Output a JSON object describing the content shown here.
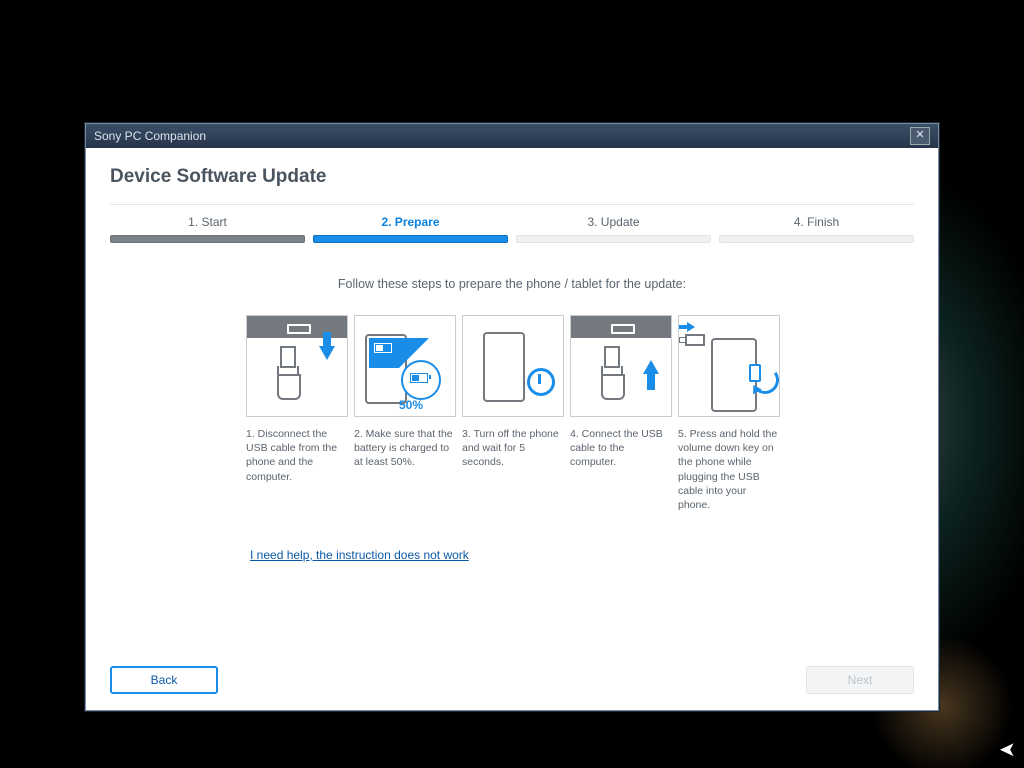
{
  "window": {
    "title": "Sony PC Companion"
  },
  "page": {
    "heading": "Device Software Update"
  },
  "steps": [
    {
      "label": "1. Start",
      "state": "done"
    },
    {
      "label": "2. Prepare",
      "state": "active"
    },
    {
      "label": "3. Update",
      "state": "pending"
    },
    {
      "label": "4. Finish",
      "state": "pending"
    }
  ],
  "instruction": "Follow these steps to prepare the phone / tablet for the update:",
  "cards": [
    {
      "text": "1. Disconnect the USB cable from the phone and the computer."
    },
    {
      "text": "2. Make sure that the battery is charged to at least 50%.",
      "pct": "50%"
    },
    {
      "text": "3. Turn off the phone and wait for 5 seconds."
    },
    {
      "text": "4. Connect the USB cable to the computer."
    },
    {
      "text": "5. Press and hold the volume down key on the phone while plugging the USB cable into your phone."
    }
  ],
  "help_link": "I need help, the instruction does not work",
  "buttons": {
    "back": "Back",
    "next": "Next"
  }
}
